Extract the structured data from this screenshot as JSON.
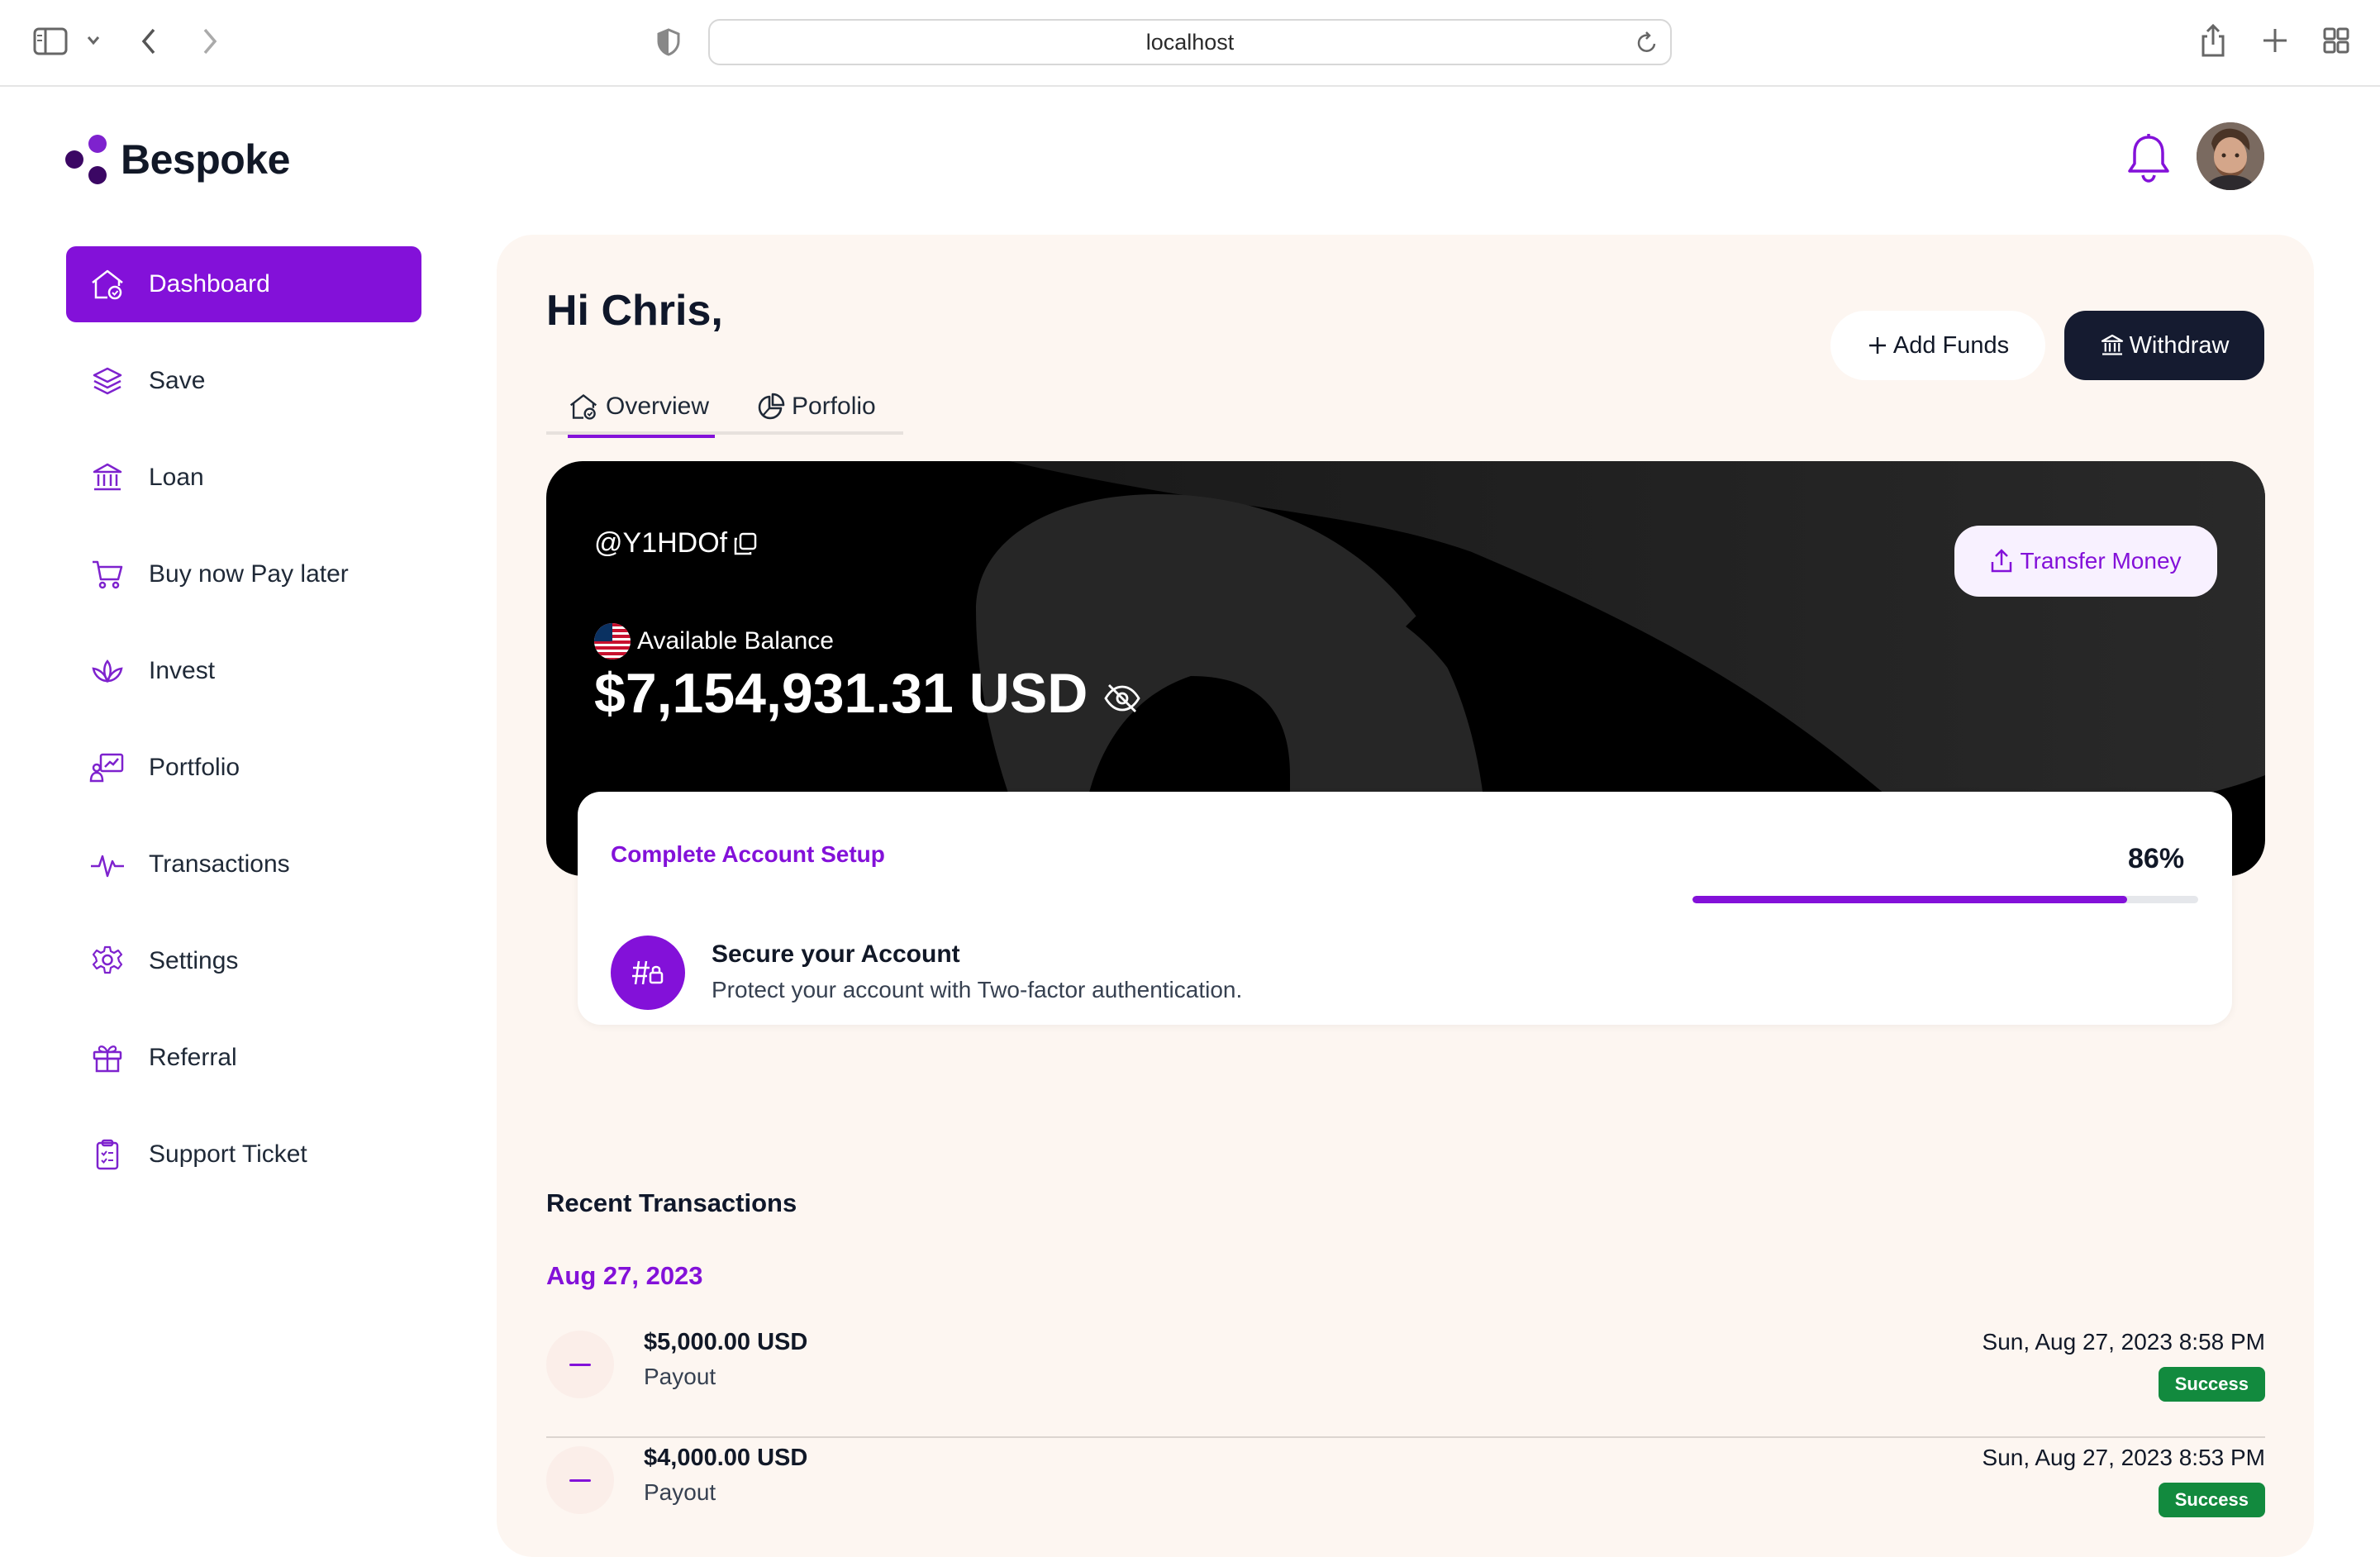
{
  "browser": {
    "url": "localhost"
  },
  "brand": {
    "name": "Bespoke",
    "accent": "#8311d9",
    "dark": "#151b30"
  },
  "sidebar": {
    "items": [
      {
        "label": "Dashboard",
        "icon": "home-icon",
        "active": true
      },
      {
        "label": "Save",
        "icon": "layers-icon"
      },
      {
        "label": "Loan",
        "icon": "bank-icon"
      },
      {
        "label": "Buy now Pay later",
        "icon": "cart-icon"
      },
      {
        "label": "Invest",
        "icon": "lotus-icon"
      },
      {
        "label": "Portfolio",
        "icon": "chart-presentation-icon"
      },
      {
        "label": "Transactions",
        "icon": "pulse-icon"
      },
      {
        "label": "Settings",
        "icon": "gear-icon"
      },
      {
        "label": "Referral",
        "icon": "gift-icon"
      },
      {
        "label": "Support Ticket",
        "icon": "clipboard-icon"
      }
    ]
  },
  "main": {
    "greeting": "Hi Chris,",
    "tabs": [
      {
        "label": "Overview",
        "active": true
      },
      {
        "label": "Porfolio"
      }
    ],
    "actions": {
      "add_funds": "Add Funds",
      "withdraw": "Withdraw"
    }
  },
  "balance_card": {
    "handle": "@Y1HDOf",
    "transfer_label": "Transfer Money",
    "available_label": "Available Balance",
    "amount": "$7,154,931.31 USD"
  },
  "setup": {
    "title": "Complete Account Setup",
    "percent_label": "86%",
    "percent": 86,
    "item_title": "Secure your Account",
    "item_desc": "Protect your account with Two-factor authentication."
  },
  "transactions": {
    "heading": "Recent Transactions",
    "date_group": "Aug 27, 2023",
    "rows": [
      {
        "amount": "$5,000.00 USD",
        "type": "Payout",
        "time": "Sun, Aug 27, 2023 8:58 PM",
        "status": "Success"
      },
      {
        "amount": "$4,000.00 USD",
        "type": "Payout",
        "time": "Sun, Aug 27, 2023 8:53 PM",
        "status": "Success"
      }
    ]
  }
}
